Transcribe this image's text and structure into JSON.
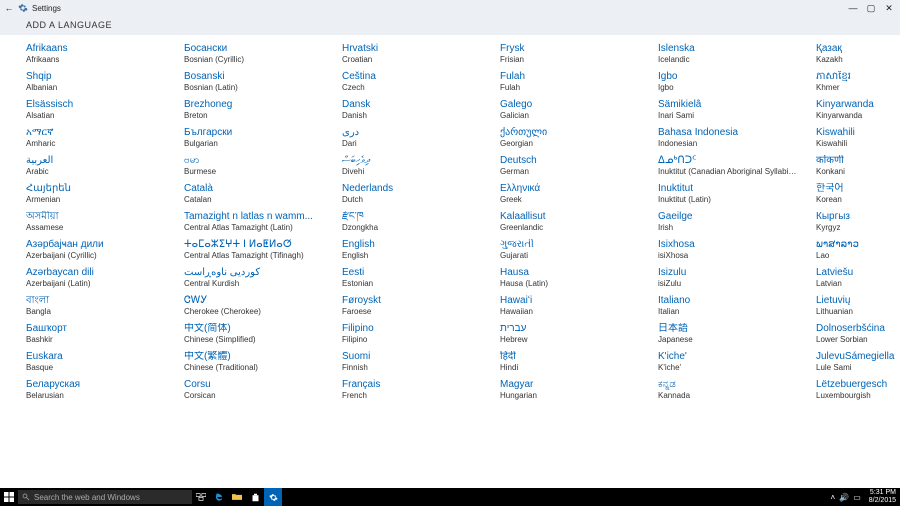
{
  "window": {
    "title": "Settings",
    "header": "ADD A LANGUAGE"
  },
  "wincontrols": {
    "min": "—",
    "max": "▢",
    "close": "✕"
  },
  "columns": [
    [
      {
        "native": "Afrikaans",
        "sub": "Afrikaans"
      },
      {
        "native": "Shqip",
        "sub": "Albanian"
      },
      {
        "native": "Elsässisch",
        "sub": "Alsatian"
      },
      {
        "native": "አማርኛ",
        "sub": "Amharic"
      },
      {
        "native": "العربية",
        "sub": "Arabic"
      },
      {
        "native": "Հայերեն",
        "sub": "Armenian"
      },
      {
        "native": "অসমীয়া",
        "sub": "Assamese"
      },
      {
        "native": "Азәрбајҹан дили",
        "sub": "Azerbaijani (Cyrillic)"
      },
      {
        "native": "Azərbaycan dili",
        "sub": "Azerbaijani (Latin)"
      },
      {
        "native": "বাংলা",
        "sub": "Bangla"
      },
      {
        "native": "Башҡорт",
        "sub": "Bashkir"
      },
      {
        "native": "Euskara",
        "sub": "Basque"
      },
      {
        "native": "Беларуская",
        "sub": "Belarusian"
      }
    ],
    [
      {
        "native": "Босански",
        "sub": "Bosnian (Cyrillic)"
      },
      {
        "native": "Bosanski",
        "sub": "Bosnian (Latin)"
      },
      {
        "native": "Brezhoneg",
        "sub": "Breton"
      },
      {
        "native": "Български",
        "sub": "Bulgarian"
      },
      {
        "native": "ဗမာ",
        "sub": "Burmese"
      },
      {
        "native": "Català",
        "sub": "Catalan"
      },
      {
        "native": "Tamazight n latlas n wamm...",
        "sub": "Central Atlas Tamazight (Latin)"
      },
      {
        "native": "ⵜⴰⵎⴰⵣⵉⵖⵜ ⵏ ⵍⴰⵟⵍⴰⵚ",
        "sub": "Central Atlas Tamazight (Tifinagh)"
      },
      {
        "native": "کوردیی ناوەڕاست",
        "sub": "Central Kurdish"
      },
      {
        "native": "ᏣᎳᎩ",
        "sub": "Cherokee (Cherokee)"
      },
      {
        "native": "中文(简体)",
        "sub": "Chinese (Simplified)"
      },
      {
        "native": "中文(繁體)",
        "sub": "Chinese (Traditional)"
      },
      {
        "native": "Corsu",
        "sub": "Corsican"
      }
    ],
    [
      {
        "native": "Hrvatski",
        "sub": "Croatian"
      },
      {
        "native": "Čeština",
        "sub": "Czech"
      },
      {
        "native": "Dansk",
        "sub": "Danish"
      },
      {
        "native": "درى",
        "sub": "Dari"
      },
      {
        "native": "ދިވެހިބަސް",
        "sub": "Divehi"
      },
      {
        "native": "Nederlands",
        "sub": "Dutch"
      },
      {
        "native": "རྫོང་ཁ",
        "sub": "Dzongkha"
      },
      {
        "native": "English",
        "sub": "English"
      },
      {
        "native": "Eesti",
        "sub": "Estonian"
      },
      {
        "native": "Føroyskt",
        "sub": "Faroese"
      },
      {
        "native": "Filipino",
        "sub": "Filipino"
      },
      {
        "native": "Suomi",
        "sub": "Finnish"
      },
      {
        "native": "Français",
        "sub": "French"
      }
    ],
    [
      {
        "native": "Frysk",
        "sub": "Frisian"
      },
      {
        "native": "Fulah",
        "sub": "Fulah"
      },
      {
        "native": "Galego",
        "sub": "Galician"
      },
      {
        "native": "ქართული",
        "sub": "Georgian"
      },
      {
        "native": "Deutsch",
        "sub": "German"
      },
      {
        "native": "Ελληνικά",
        "sub": "Greek"
      },
      {
        "native": "Kalaallisut",
        "sub": "Greenlandic"
      },
      {
        "native": "ગુજરાતી",
        "sub": "Gujarati"
      },
      {
        "native": "Hausa",
        "sub": "Hausa (Latin)"
      },
      {
        "native": "Hawaiʻi",
        "sub": "Hawaiian"
      },
      {
        "native": "עברית",
        "sub": "Hebrew"
      },
      {
        "native": "हिंदी",
        "sub": "Hindi"
      },
      {
        "native": "Magyar",
        "sub": "Hungarian"
      }
    ],
    [
      {
        "native": "Íslenska",
        "sub": "Icelandic"
      },
      {
        "native": "Igbo",
        "sub": "Igbo"
      },
      {
        "native": "Sämikielâ",
        "sub": "Inari Sami"
      },
      {
        "native": "Bahasa Indonesia",
        "sub": "Indonesian"
      },
      {
        "native": "ᐃᓄᒃᑎᑐᑦ",
        "sub": "Inuktitut (Canadian Aboriginal Syllabics)"
      },
      {
        "native": "Inuktitut",
        "sub": "Inuktitut (Latin)"
      },
      {
        "native": "Gaeilge",
        "sub": "Irish"
      },
      {
        "native": "Isixhosa",
        "sub": "isiXhosa"
      },
      {
        "native": "Isizulu",
        "sub": "isiZulu"
      },
      {
        "native": "Italiano",
        "sub": "Italian"
      },
      {
        "native": "日本語",
        "sub": "Japanese"
      },
      {
        "native": "K'iche'",
        "sub": "K'iche'"
      },
      {
        "native": "ಕನ್ನಡ",
        "sub": "Kannada"
      }
    ],
    [
      {
        "native": "Қазақ",
        "sub": "Kazakh"
      },
      {
        "native": "ភាសាខ្មែរ",
        "sub": "Khmer"
      },
      {
        "native": "Kinyarwanda",
        "sub": "Kinyarwanda"
      },
      {
        "native": "Kiswahili",
        "sub": "Kiswahili"
      },
      {
        "native": "कोंकणी",
        "sub": "Konkani"
      },
      {
        "native": "한국어",
        "sub": "Korean"
      },
      {
        "native": "Кыргыз",
        "sub": "Kyrgyz"
      },
      {
        "native": "ພາສາລາວ",
        "sub": "Lao"
      },
      {
        "native": "Latviešu",
        "sub": "Latvian"
      },
      {
        "native": "Lietuvių",
        "sub": "Lithuanian"
      },
      {
        "native": "Dolnoserbšćina",
        "sub": "Lower Sorbian"
      },
      {
        "native": "JulevuSámegiella",
        "sub": "Lule Sami"
      },
      {
        "native": "Lëtzebuergesch",
        "sub": "Luxembourgish"
      }
    ]
  ],
  "taskbar": {
    "search_placeholder": "Search the web and Windows",
    "time": "5:31 PM",
    "date": "8/2/2015"
  }
}
